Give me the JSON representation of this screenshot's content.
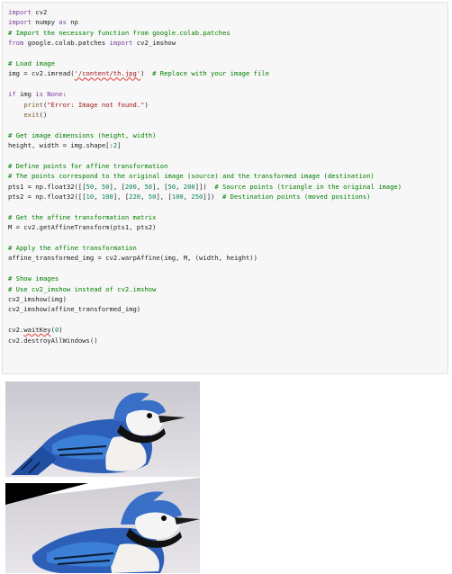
{
  "code_lines": [
    "import cv2",
    "import numpy as np",
    "# Import the necessary function from google.colab.patches",
    "from google.colab.patches import cv2_imshow",
    "",
    "# Load image",
    "img = cv2.imread('/content/th.jpg')  # Replace with your image file",
    "",
    "if img is None:",
    "    print(\"Error: Image not found.\")",
    "    exit()",
    "",
    "# Get image dimensions (height, width)",
    "height, width = img.shape[:2]",
    "",
    "# Define points for affine transformation",
    "# The points correspond to the original image (source) and the transformed image (destination)",
    "pts1 = np.float32([[50, 50], [200, 50], [50, 200]])  # Source points (triangle in the original image)",
    "pts2 = np.float32([[10, 100], [220, 50], [100, 250]])  # Destination points (moved positions)",
    "",
    "# Get the affine transformation matrix",
    "M = cv2.getAffineTransform(pts1, pts2)",
    "",
    "# Apply the affine transformation",
    "affine_transformed_img = cv2.warpAffine(img, M, (width, height))",
    "",
    "# Show images",
    "# Use cv2_imshow instead of cv2.imshow",
    "cv2_imshow(img)",
    "cv2_imshow(affine_transformed_img)",
    "",
    "cv2.waitKey(0)",
    "cv2.destroyAllWindows()"
  ],
  "outputs": [
    {
      "icon": "blue-jay-original-image"
    },
    {
      "icon": "blue-jay-affine-transformed-image"
    }
  ],
  "colors": {
    "cell_background": "#f7f7f7",
    "comment": "#008000",
    "keyword": "#7a3e9d",
    "string": "#a31515",
    "number": "#098658"
  }
}
